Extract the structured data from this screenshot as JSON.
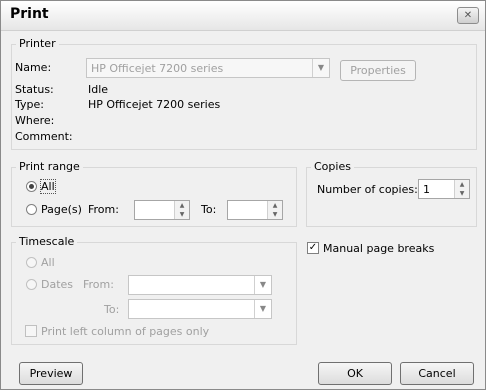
{
  "dialog": {
    "title": "Print",
    "close_glyph": "✕"
  },
  "printer": {
    "group_label": "Printer",
    "name_label": "Name:",
    "name_value": "HP Officejet 7200 series",
    "properties_button": "Properties",
    "status_label": "Status:",
    "status_value": "Idle",
    "type_label": "Type:",
    "type_value": "HP Officejet 7200 series",
    "where_label": "Where:",
    "where_value": "",
    "comment_label": "Comment:",
    "comment_value": ""
  },
  "print_range": {
    "group_label": "Print range",
    "all_label": "All",
    "pages_label": "Page(s)",
    "from_label": "From:",
    "to_label": "To:",
    "from_value": "",
    "to_value": "",
    "selected": "all"
  },
  "copies": {
    "group_label": "Copies",
    "number_label": "Number of copies:",
    "number_value": "1"
  },
  "manual_page_breaks": {
    "label": "Manual page breaks",
    "checked": true
  },
  "timescale": {
    "group_label": "Timescale",
    "all_label": "All",
    "dates_label": "Dates",
    "from_label": "From:",
    "to_label": "To:",
    "print_left_label": "Print left column of pages only"
  },
  "buttons": {
    "preview": "Preview",
    "ok": "OK",
    "cancel": "Cancel"
  },
  "icons": {
    "dropdown": "▼",
    "spin_up": "▲",
    "spin_down": "▼",
    "check": "✓"
  }
}
